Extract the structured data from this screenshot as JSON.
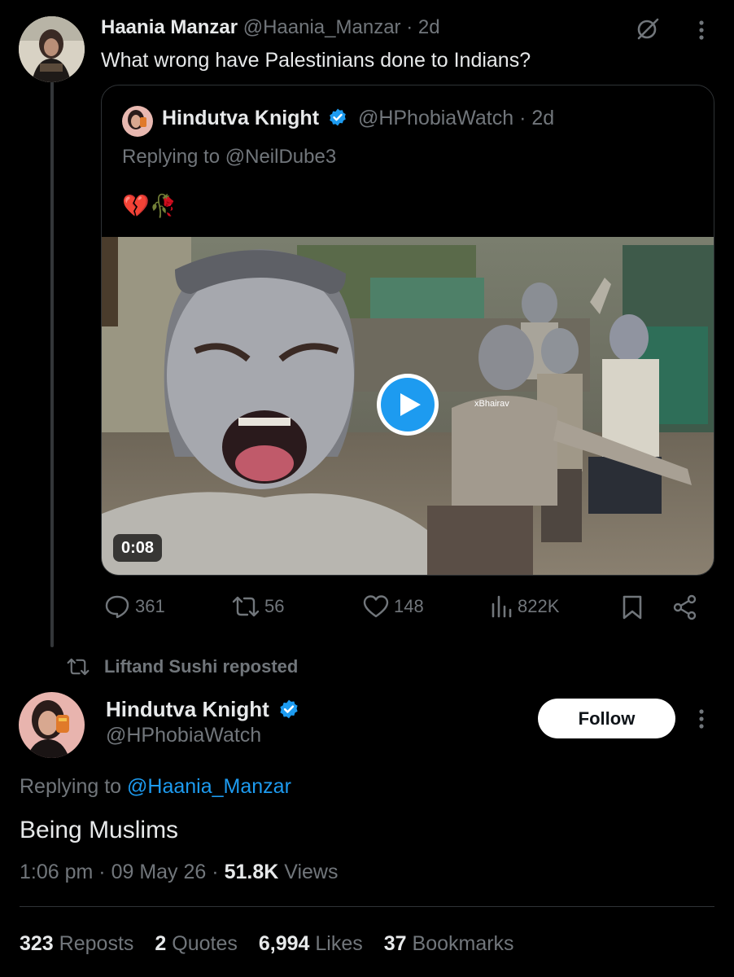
{
  "tweet1": {
    "author_name": "Haania Manzar",
    "handle_time": "@Haania_Manzar · 2d",
    "text": "What wrong have Palestinians done to Indians?"
  },
  "quoted": {
    "author_name": "Hindutva Knight",
    "handle_time": "@HPhobiaWatch · 2d",
    "replying_prefix": "Replying to",
    "replying_to": "@NeilDube3",
    "emoji": "💔🥀",
    "video_watermark": "xBhairav",
    "video_duration": "0:08"
  },
  "actions": {
    "replies": "361",
    "reposts": "56",
    "likes": "148",
    "views": "822K"
  },
  "repost_banner": "Liftand Sushi reposted",
  "tweet2": {
    "author_name": "Hindutva Knight",
    "handle": "@HPhobiaWatch",
    "follow_label": "Follow",
    "replying_prefix": "Replying to",
    "replying_to": "@Haania_Manzar",
    "text": "Being Muslims",
    "time": "1:06 pm",
    "date": "09 May 26",
    "views_count": "51.8K",
    "views_label": "Views"
  },
  "stats": {
    "reposts_count": "323",
    "reposts_label": "Reposts",
    "quotes_count": "2",
    "quotes_label": "Quotes",
    "likes_count": "6,994",
    "likes_label": "Likes",
    "bookmarks_count": "37",
    "bookmarks_label": "Bookmarks"
  },
  "colors": {
    "background": "#000000",
    "text": "#e7e9ea",
    "muted": "#71767b",
    "link": "#1d9bf0",
    "border": "#2f3336"
  }
}
